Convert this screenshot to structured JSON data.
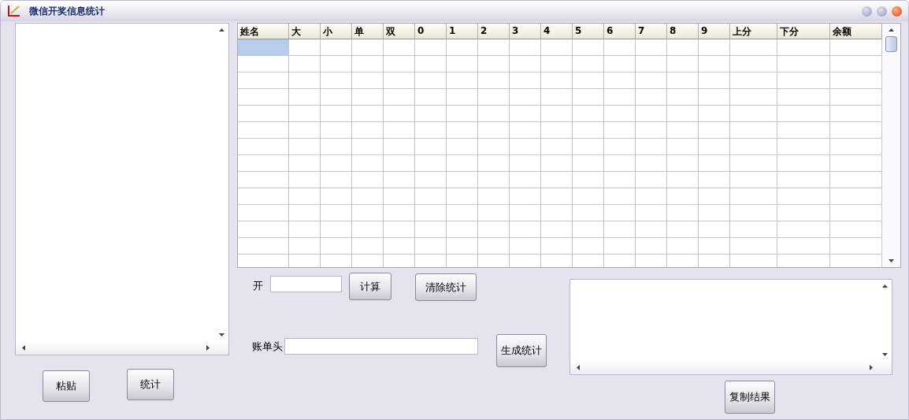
{
  "window": {
    "title": "微信开奖信息统计"
  },
  "input_panel": {
    "buttons": [
      "粘贴",
      "统计"
    ]
  },
  "grid": {
    "columns": [
      "姓名",
      "大",
      "小",
      "单",
      "双",
      "0",
      "1",
      "2",
      "3",
      "4",
      "5",
      "6",
      "7",
      "8",
      "9",
      "上分",
      "下分",
      "余额"
    ],
    "rows": [
      {
        "selected": true
      },
      {
        "selected": false
      },
      {
        "selected": false
      },
      {
        "selected": false
      },
      {
        "selected": false
      },
      {
        "selected": false
      },
      {
        "selected": false
      },
      {
        "selected": false
      },
      {
        "selected": false
      },
      {
        "selected": false
      },
      {
        "selected": false
      },
      {
        "selected": false
      },
      {
        "selected": false
      },
      {
        "selected": false
      }
    ]
  },
  "open": {
    "label": "开",
    "calc_button": "计算",
    "clear_button": "清除统计"
  },
  "bill": {
    "label": "账单头",
    "generate_button": "生成统计"
  },
  "result": {
    "copy_button": "复制结果"
  }
}
